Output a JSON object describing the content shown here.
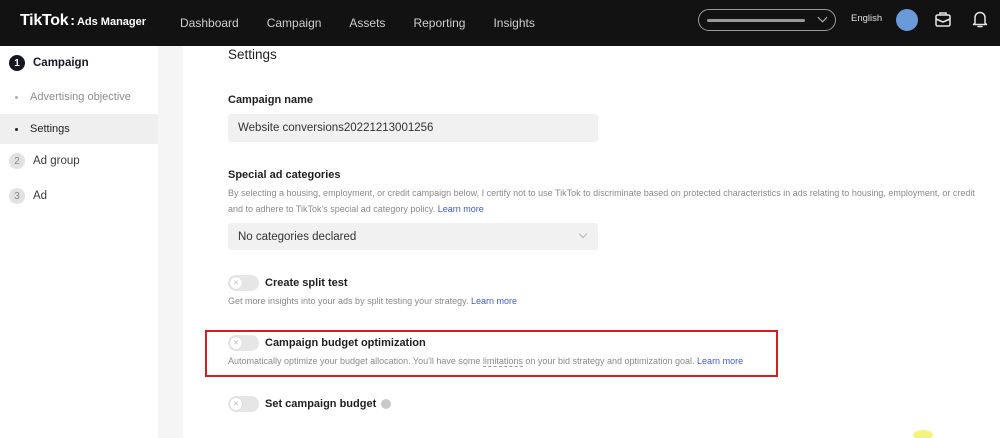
{
  "header": {
    "logo_main": "TikTok",
    "logo_sep": ":",
    "logo_sub": "Ads Manager",
    "nav": [
      "Dashboard",
      "Campaign",
      "Assets",
      "Reporting",
      "Insights"
    ],
    "language": "English"
  },
  "sidebar": {
    "campaign_step": {
      "number": "1",
      "label": "Campaign"
    },
    "substeps": [
      {
        "label": "Advertising objective"
      },
      {
        "label": "Settings"
      }
    ],
    "ad_group_step": {
      "number": "2",
      "label": "Ad group"
    },
    "ad_step": {
      "number": "3",
      "label": "Ad"
    }
  },
  "main": {
    "section_title": "Settings",
    "campaign_name": {
      "label": "Campaign name",
      "value": "Website conversions20221213001256"
    },
    "special_ad": {
      "label": "Special ad categories",
      "help_line1": "By selecting a housing, employment, or credit campaign below, I certify not to use TikTok to discriminate based on protected characteristics in ads relating to housing, employment, or credit",
      "help_line2": "and to adhere to TikTok's special ad category policy.",
      "learn_more": "Learn more",
      "selected": "No categories declared"
    },
    "split_test": {
      "label": "Create split test",
      "help": "Get more insights into your ads by split testing your strategy.",
      "learn_more": "Learn more",
      "enabled": false
    },
    "budget_optimization": {
      "label": "Campaign budget optimization",
      "help_before": "Automatically optimize your budget allocation. You'll have some",
      "help_link": "limitations",
      "help_after": "on your bid strategy and optimization goal.",
      "learn_more": "Learn more",
      "enabled": false
    },
    "set_budget": {
      "label": "Set campaign budget",
      "enabled": false
    }
  },
  "colors": {
    "topbar": "#121212",
    "accent_link": "#3c5bd6",
    "highlight": "#d22020"
  }
}
